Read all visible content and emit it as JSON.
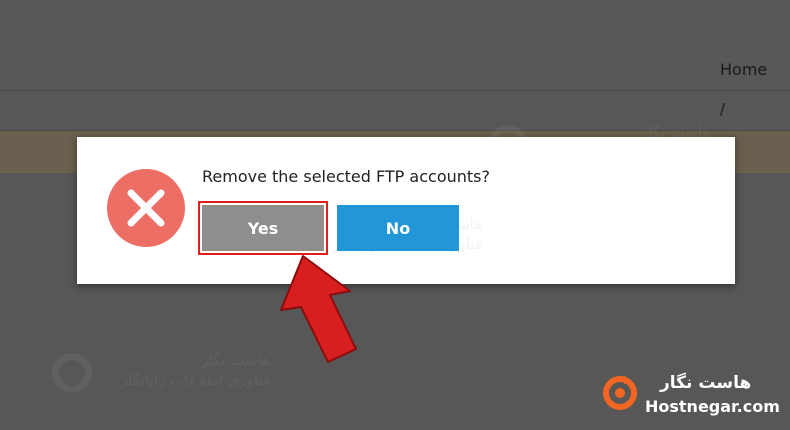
{
  "background": {
    "nav_home": "Home",
    "breadcrumb_separator": "/"
  },
  "watermark": {
    "brand_fa": "هاست نگار",
    "tagline_fa": "فناوری اطلاعات رایانگار"
  },
  "dialog": {
    "message": "Remove the selected FTP accounts?",
    "yes_label": "Yes",
    "no_label": "No",
    "icon": "close-icon"
  },
  "annotation": {
    "arrow_icon": "red-arrow-icon",
    "highlight_color": "#e21d1d"
  },
  "brand": {
    "name_fa": "هاست نگار",
    "domain": "Hostnegar.com",
    "logo_icon": "hostnegar-logo-icon",
    "accent": "#f26522"
  },
  "colors": {
    "error_red": "#ec6e65",
    "yes_gray": "#8e8e8e",
    "no_blue": "#2296d6"
  }
}
